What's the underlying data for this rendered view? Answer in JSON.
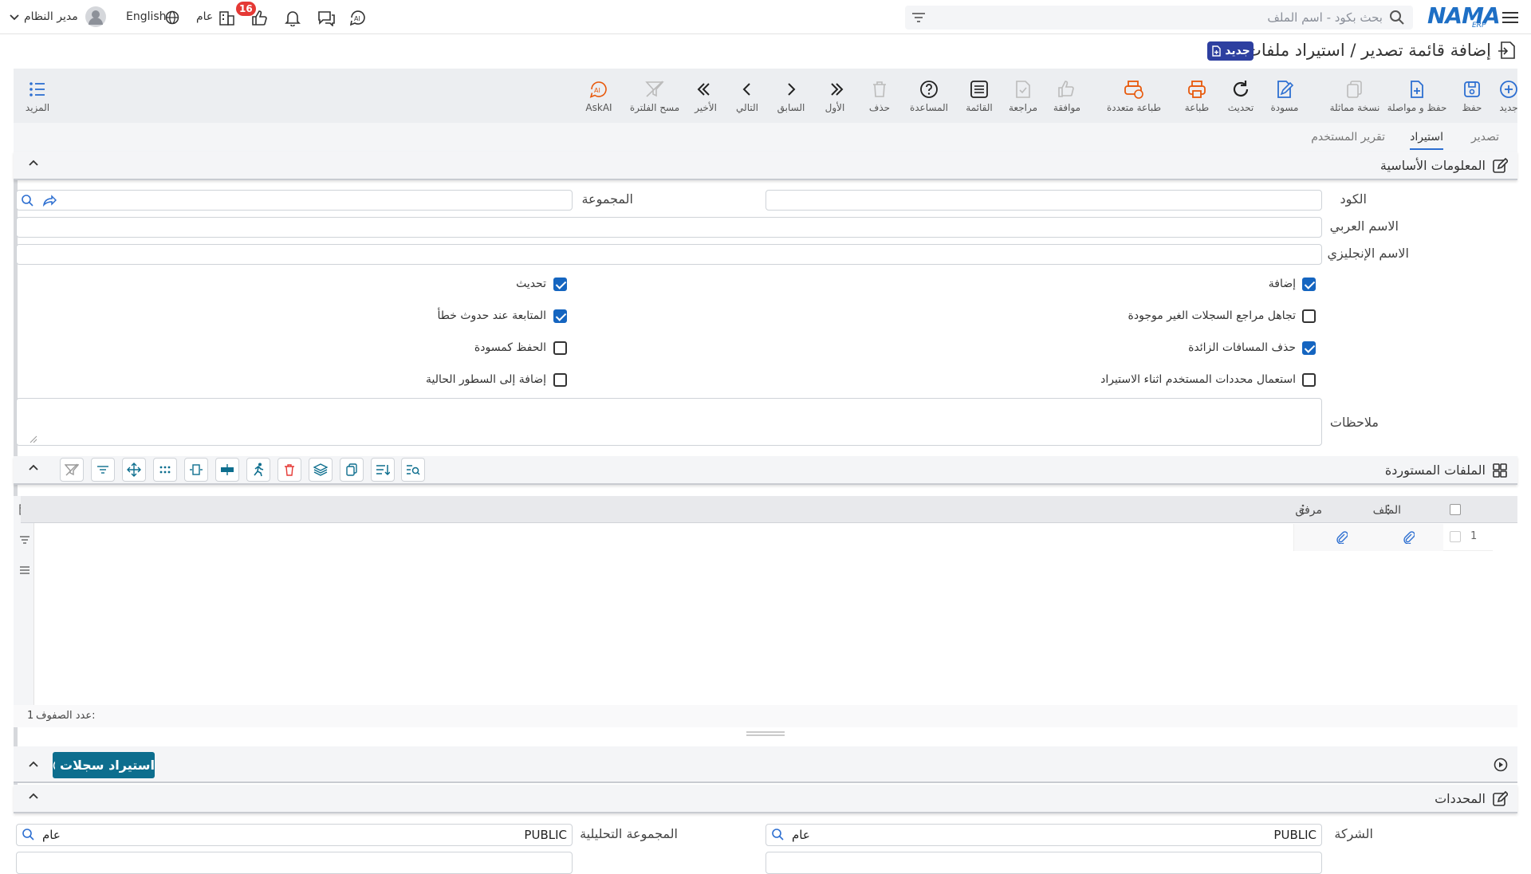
{
  "header": {
    "brand": "NAMA",
    "brand_sub": "ERP",
    "search_placeholder": "بحث بكود - اسم الملف",
    "user_name": "مدير النظام",
    "language": "English",
    "scope": "عام",
    "notification_count": "16"
  },
  "page": {
    "title": "إضافة قائمة تصدير / استيراد ملفات",
    "new_badge": "جديد"
  },
  "toolbar": {
    "items": [
      {
        "label": "جديد",
        "icon": "plus-circle-icon"
      },
      {
        "label": "حفظ",
        "icon": "save-icon"
      },
      {
        "label": "حفظ و مواصلة",
        "icon": "file-plus-icon"
      },
      {
        "label": "نسخة مماثلة",
        "icon": "copy-icon"
      },
      {
        "label": "مسودة",
        "icon": "draft-icon"
      },
      {
        "label": "تحديث",
        "icon": "refresh-icon"
      },
      {
        "label": "طباعة",
        "icon": "print-icon"
      },
      {
        "label": "طباعة متعددة",
        "icon": "multi-print-icon"
      },
      {
        "label": "موافقة",
        "icon": "thumbs-up-icon"
      },
      {
        "label": "مراجعة",
        "icon": "review-icon"
      },
      {
        "label": "القائمة",
        "icon": "list-icon"
      },
      {
        "label": "المساعدة",
        "icon": "help-icon"
      },
      {
        "label": "حذف",
        "icon": "trash-icon"
      },
      {
        "label": "الأول",
        "icon": "first-icon"
      },
      {
        "label": "السابق",
        "icon": "prev-icon"
      },
      {
        "label": "التالي",
        "icon": "next-icon"
      },
      {
        "label": "الأخير",
        "icon": "last-icon"
      },
      {
        "label": "مسح الفلترة",
        "icon": "clear-filter-icon"
      },
      {
        "label": "AskAI",
        "icon": "ai-icon"
      }
    ],
    "more": "المزيد"
  },
  "tabs": [
    "تصدير",
    "استيراد",
    "تقرير المستخدم"
  ],
  "basic": {
    "title": "المعلومات الأساسية",
    "code_label": "الكود",
    "group_label": "المجموعة",
    "arabic_name_label": "الاسم العربي",
    "english_name_label": "الاسم الإنجليزي",
    "notes_label": "ملاحظات",
    "checks": [
      {
        "label": "إضافة",
        "checked": true
      },
      {
        "label": "تحديث",
        "checked": true
      },
      {
        "label": "تجاهل مراجع السجلات الغير موجودة",
        "checked": false
      },
      {
        "label": "المتابعة عند حدوث خطأ",
        "checked": true
      },
      {
        "label": "حذف المسافات الزائدة",
        "checked": true
      },
      {
        "label": "الحفظ كمسودة",
        "checked": false
      },
      {
        "label": "استعمال محددات المستخدم اثناء الاستيراد",
        "checked": false
      },
      {
        "label": "إضافة إلى السطور الحالية",
        "checked": false
      }
    ]
  },
  "files": {
    "title": "الملفات المستوردة",
    "columns": [
      "الملف",
      "مرفق"
    ],
    "rows": [
      {
        "num": "1"
      }
    ],
    "rows_count_label": "عدد الصفوف:",
    "rows_count": "1"
  },
  "import_button": "استيراد سجلات",
  "determinants": {
    "title": "المحددات",
    "company_label": "الشركة",
    "company_value": "PUBLIC",
    "company_scope": "عام",
    "analytic_label": "المجموعة التحليلية",
    "analytic_value": "PUBLIC",
    "analytic_scope": "عام"
  },
  "colors": {
    "accent": "#2d6fd1",
    "brand": "#1565c0",
    "new_badge": "#2d3fa0",
    "import_btn": "#0d6e8e",
    "print_orange": "#e8590c",
    "badge_red": "#e53935"
  }
}
